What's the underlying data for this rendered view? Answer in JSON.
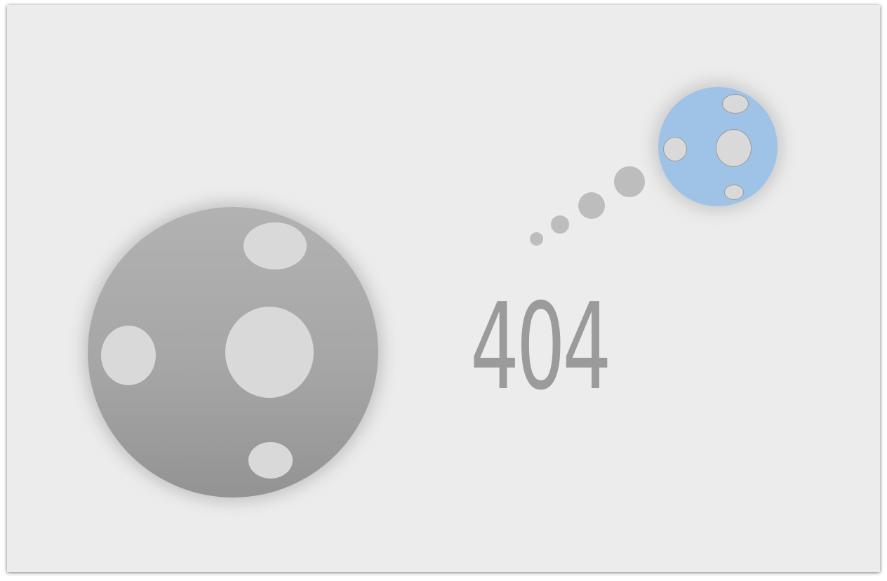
{
  "error": {
    "code": "404"
  },
  "colors": {
    "background": "#ececec",
    "large_planet": "#a6a6a6",
    "small_planet": "#9fc3e7",
    "crater": "#d9d9d9",
    "trail_dot": "#bdbdbd",
    "code_text": "#9b9b9b"
  }
}
